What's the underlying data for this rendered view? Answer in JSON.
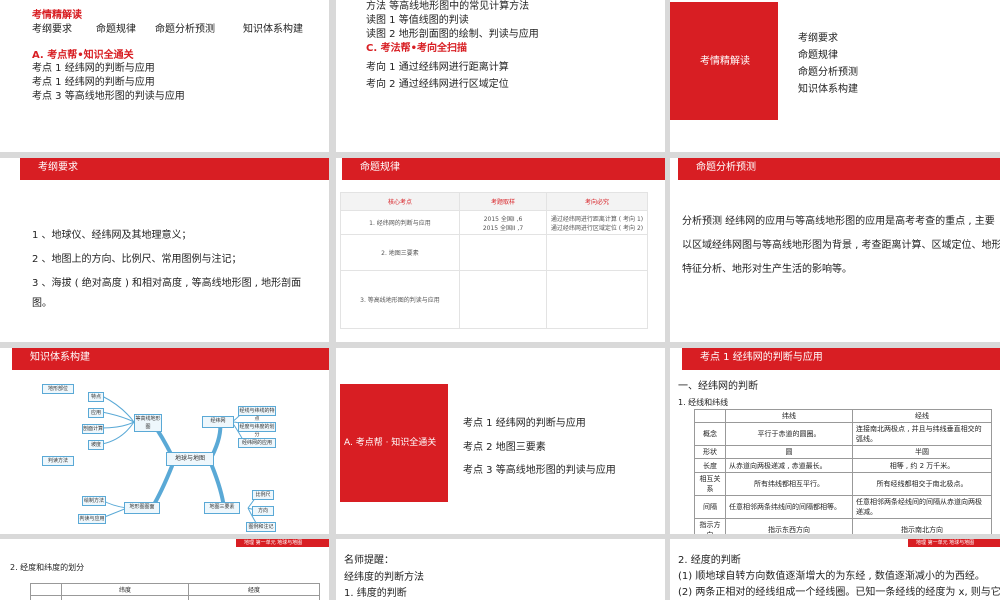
{
  "s1": {
    "title": "考情精解读",
    "nav": [
      "考纲要求",
      "命题规律",
      "命题分析预测",
      "知识体系构建"
    ],
    "sectionA": "A. 考点帮•知识全通关",
    "points": [
      "考点 1  经纬网的判断与应用",
      "考点 1  经纬网的判断与应用",
      "考点 3  等高线地形图的判读与应用"
    ]
  },
  "s2": {
    "lines": [
      "方法  等高线地形图中的常见计算方法",
      "读图 1    等值线图的判读",
      "读图 2    地形剖面图的绘制、判读与应用"
    ],
    "sectionC": "C. 考法帮•考向全扫描",
    "directions": [
      "考向 1  通过经纬网进行距离计算",
      "考向 2  通过经纬网进行区域定位"
    ]
  },
  "s3": {
    "box": "考情精解读",
    "items": [
      "考纲要求",
      "命题规律",
      "命题分析预测",
      "知识体系构建"
    ]
  },
  "s4": {
    "tab": "考纲要求",
    "items": [
      "1 、地球仪、经纬网及其地理意义；",
      "2 、地图上的方向、比例尺、常用图例与注记；",
      "3 、海拔 ( 绝对高度 ) 和相对高度 , 等高线地形图 , 地形剖面",
      "图。"
    ]
  },
  "s5": {
    "tab": "命题规律",
    "headers": [
      "核心考点",
      "考题取样",
      "考向必究"
    ],
    "rows": [
      {
        "point": "1. 经纬网的判断与应用",
        "samples": [
          "2015 全国I ,6",
          "2015 全国II ,7"
        ],
        "dirs": [
          "通过经纬网进行距离计算 ( 考向 1)",
          "通过经纬网进行区域定位 ( 考向 2)"
        ]
      },
      {
        "point": "2. 地图三要素",
        "samples": [],
        "dirs": []
      },
      {
        "point": "3. 等高线地形图的判读与应用",
        "samples": [],
        "dirs": []
      }
    ]
  },
  "s6": {
    "tab": "命题分析预测",
    "text": [
      "分析预测    经纬网的应用与等高线地形图的应用是高考考查的重点 , 主要",
      "以区域经纬网图与等高线地形图为背景 , 考查距离计算、区域定位、地形",
      "特征分析、地形对生产生活的影响等。"
    ]
  },
  "s7": {
    "tab": "知识体系构建",
    "center": "地球与地图",
    "nodes": [
      "等高线地形图",
      "经纬网",
      "地图三要素",
      "地形图图面",
      "特点",
      "应用",
      "剖面计算",
      "坡度",
      "地形部位",
      "判读方法",
      "经线与纬线的特点",
      "经度与纬度的划分",
      "经纬网的应用",
      "比例尺",
      "方向",
      "图例和注记",
      "绘制方法",
      "判读与应用"
    ]
  },
  "s8": {
    "box": "A. 考点帮 · 知识全通关",
    "items": [
      "考点 1  经纬网的判断与应用",
      "考点 2  地图三要素",
      "考点 3  等高线地形图的判读与应用"
    ]
  },
  "s9": {
    "tab": "考点 1   经纬网的判断与应用",
    "heading": "一、经纬网的判断",
    "sub": "1. 经线和纬线",
    "colHeaders": [
      "纬线",
      "经线"
    ],
    "rows": [
      {
        "label": "概念",
        "lat": "平行于赤道的圆圈。",
        "lon": "连接南北两极点 , 并且与纬线垂直相交的弧线。"
      },
      {
        "label": "形状",
        "lat": "圆",
        "lon": "半圆"
      },
      {
        "label": "长度",
        "lat": "从赤道向两极递减 , 赤道最长。",
        "lon": "相等 , 约 2 万千米。"
      },
      {
        "label": "相互关系",
        "lat": "所有纬线都相互平行。",
        "lon": "所有经线都相交于南北极点。"
      },
      {
        "label": "间隔",
        "lat": "任意相邻两条纬线间的间隔都相等。",
        "lon": "任意相邻两条经线间的间隔从赤道向两极递减。"
      },
      {
        "label": "指示方向",
        "lat": "指示东西方向",
        "lon": "指示南北方向"
      }
    ]
  },
  "s10": {
    "footer": "地理 第一单元  地球与地图",
    "sub": "2. 经度和纬度的划分",
    "colHeaders": [
      "纬度",
      "经度"
    ]
  },
  "s11": {
    "tip": "名师提醒：",
    "line1": "经纬度的判断方法",
    "line2": "1. 纬度的判断"
  },
  "s12": {
    "footer": "地理 第一单元  地球与地图",
    "heading": "2. 经度的判断",
    "line1": "(1) 顺地球自转方向数值逐渐增大的为东经 , 数值逐渐减小的为西经。",
    "line2": "(2) 两条正相对的经线组成一个经线圈。已知一条经线的经度为 x, 则与它"
  },
  "colors": {
    "accent": "#d81e23",
    "divider": "#d9d9d9",
    "mindmap": "#5aa9d6"
  }
}
